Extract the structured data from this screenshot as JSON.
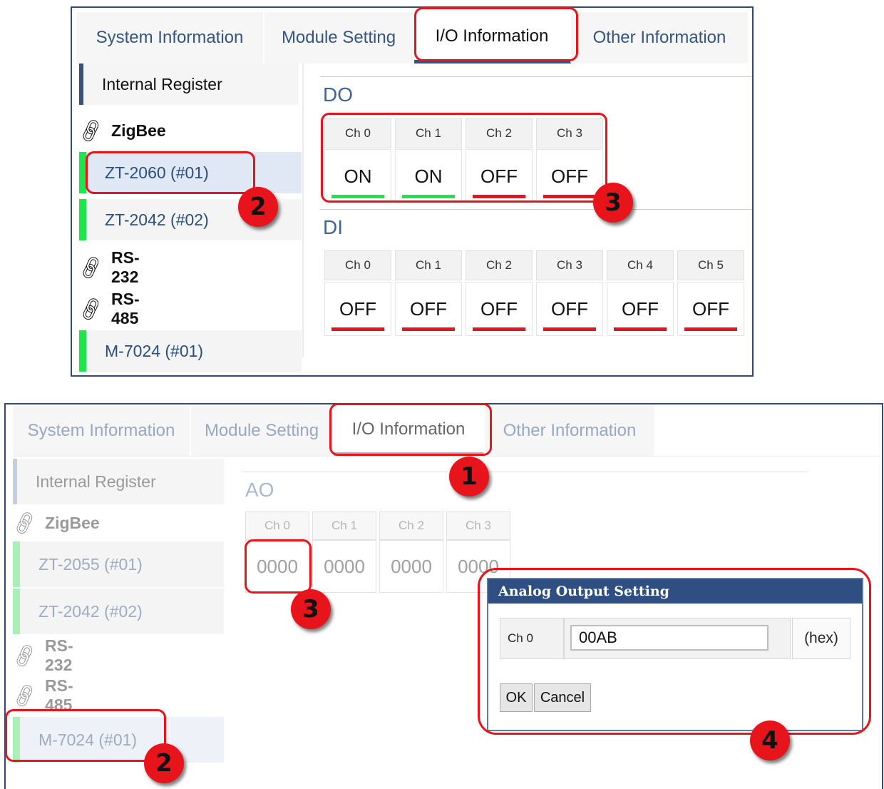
{
  "top": {
    "tabs": [
      "System Information",
      "Module Setting",
      "I/O Information",
      "Other Information"
    ],
    "active_tab": "I/O Information",
    "sidebar": {
      "internal_register": "Internal Register",
      "zigbee": "ZigBee",
      "zigbee_devices": [
        "ZT-2060 (#01)",
        "ZT-2042 (#02)"
      ],
      "rs232": "RS-232",
      "rs485": "RS-485",
      "rs485_devices": [
        "M-7024 (#01)"
      ]
    },
    "do": {
      "title": "DO",
      "channels": [
        {
          "label": "Ch 0",
          "value": "ON",
          "color": "#1ee54c"
        },
        {
          "label": "Ch 1",
          "value": "ON",
          "color": "#1ee54c"
        },
        {
          "label": "Ch 2",
          "value": "OFF",
          "color": "#e8141c"
        },
        {
          "label": "Ch 3",
          "value": "OFF",
          "color": "#e8141c"
        }
      ]
    },
    "di": {
      "title": "DI",
      "channels": [
        {
          "label": "Ch 0",
          "value": "OFF",
          "color": "#e8141c"
        },
        {
          "label": "Ch 1",
          "value": "OFF",
          "color": "#e8141c"
        },
        {
          "label": "Ch 2",
          "value": "OFF",
          "color": "#e8141c"
        },
        {
          "label": "Ch 3",
          "value": "OFF",
          "color": "#e8141c"
        },
        {
          "label": "Ch 4",
          "value": "OFF",
          "color": "#e8141c"
        },
        {
          "label": "Ch 5",
          "value": "OFF",
          "color": "#e8141c"
        }
      ]
    },
    "markers": [
      "2",
      "3"
    ]
  },
  "bottom": {
    "tabs": [
      "System Information",
      "Module Setting",
      "I/O Information",
      "Other Information"
    ],
    "active_tab": "I/O Information",
    "sidebar": {
      "internal_register": "Internal Register",
      "zigbee": "ZigBee",
      "zigbee_devices": [
        "ZT-2055 (#01)",
        "ZT-2042 (#02)"
      ],
      "rs232": "RS-232",
      "rs485": "RS-485",
      "rs485_devices": [
        "M-7024 (#01)"
      ]
    },
    "ao": {
      "title": "AO",
      "channels": [
        {
          "label": "Ch 0",
          "value": "0000"
        },
        {
          "label": "Ch 1",
          "value": "0000"
        },
        {
          "label": "Ch 2",
          "value": "0000"
        },
        {
          "label": "Ch 3",
          "value": "0000"
        }
      ]
    },
    "dialog": {
      "title": "Analog Output Setting",
      "channel_label": "Ch 0",
      "value": "00AB",
      "unit": "(hex)",
      "ok": "OK",
      "cancel": "Cancel"
    },
    "markers": [
      "1",
      "2",
      "3",
      "4"
    ]
  },
  "colors": {
    "accent": "#2f4f83",
    "on": "#1ee54c",
    "off": "#e8141c",
    "annotation": "#e8141c"
  }
}
